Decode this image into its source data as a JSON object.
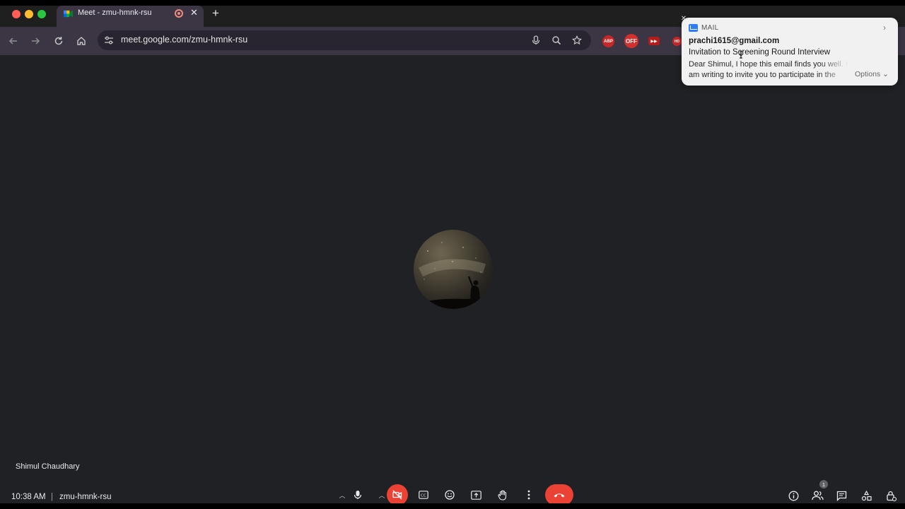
{
  "browser": {
    "tab": {
      "title": "Meet - zmu-hmnk-rsu",
      "close": "✕"
    },
    "new_tab": "+",
    "url": "meet.google.com/zmu-hmnk-rsu",
    "extensions": {
      "abp": "ABP",
      "off": "OFF",
      "hd": "HD"
    }
  },
  "meet": {
    "participant_name": "Shimul Chaudhary",
    "time": "10:38 AM",
    "separator": "|",
    "meeting_code": "zmu-hmnk-rsu",
    "participants_count": "1",
    "colors": {
      "end_call": "#ea4335",
      "camera_off": "#ea4335",
      "background": "#202124"
    }
  },
  "notification": {
    "app": "MAIL",
    "from": "prachi1615@gmail.com",
    "subject": "Invitation to Screening Round Interview",
    "body": "Dear Shimul, I hope this email finds you well. I am writing to invite you to participate in the screening round",
    "options_label": "Options ⌄",
    "close": "✕",
    "chevron": "›"
  }
}
